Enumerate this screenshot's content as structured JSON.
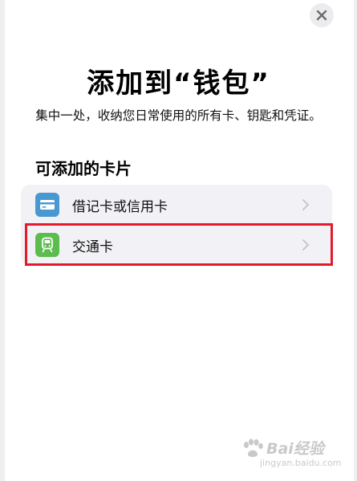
{
  "close_button": {
    "icon": "close-icon"
  },
  "header": {
    "title": "添加到“钱包”",
    "subtitle": "集中一处，收纳您日常使用的所有卡、钥匙和凭证。"
  },
  "section": {
    "title": "可添加的卡片",
    "items": [
      {
        "label": "借记卡或信用卡",
        "icon": "credit-card-icon",
        "icon_color": "#4a98d0"
      },
      {
        "label": "交通卡",
        "icon": "train-icon",
        "icon_color": "#5cbd4f"
      }
    ]
  },
  "annotation": {
    "highlight_color": "#e3192c"
  },
  "watermark": {
    "text": "Bai经验",
    "url": "jingyan.baidu.com"
  }
}
